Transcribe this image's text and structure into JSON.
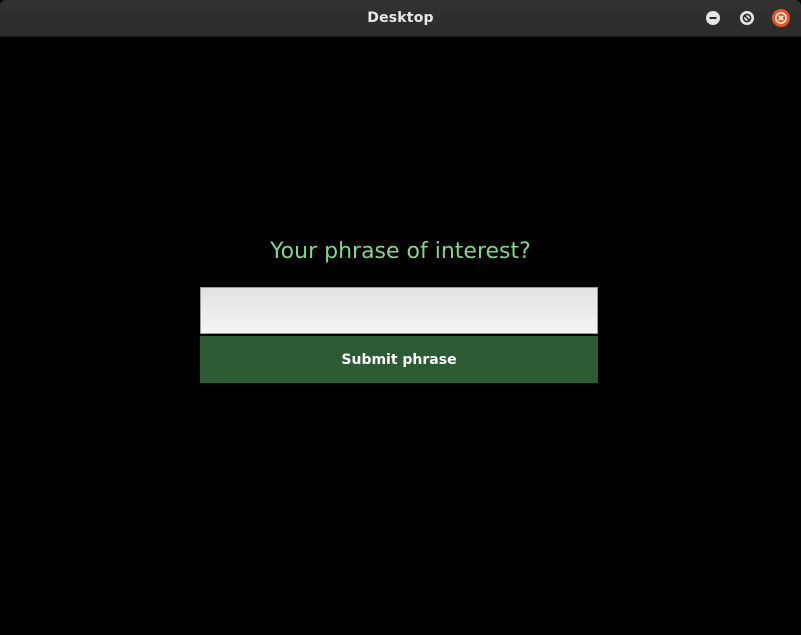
{
  "window": {
    "title": "Desktop",
    "controls": {
      "minimize_icon": "minimize-icon",
      "maximize_icon": "maximize-icon",
      "close_icon": "close-icon"
    }
  },
  "main": {
    "prompt": "Your phrase of interest?",
    "phrase_input": {
      "value": "",
      "placeholder": ""
    },
    "submit_label": "Submit phrase"
  },
  "colors": {
    "background": "#000000",
    "prompt_text": "#7fd88a",
    "submit_button": "#2d5b33",
    "close_button": "#e9541f"
  }
}
